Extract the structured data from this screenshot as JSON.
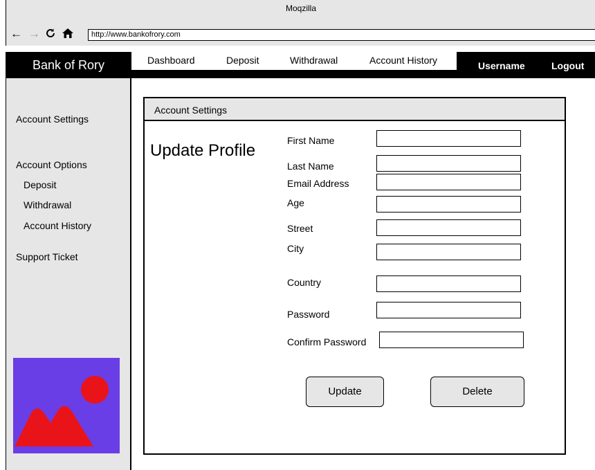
{
  "browser": {
    "window_title": "Moqzilla",
    "url": "http://www.bankofrory.com",
    "icons": [
      "arrow-left-icon",
      "arrow-right-icon",
      "reload-icon",
      "home-icon"
    ]
  },
  "topbar": {
    "brand": "Bank of Rory",
    "tabs": [
      {
        "label": "Dashboard"
      },
      {
        "label": "Deposit"
      },
      {
        "label": "Withdrawal"
      },
      {
        "label": "Account History"
      }
    ],
    "username": "Username",
    "logout": "Logout"
  },
  "sidebar": {
    "account_settings": "Account Settings",
    "account_options": "Account Options",
    "options": [
      {
        "label": "Deposit"
      },
      {
        "label": "Withdrawal"
      },
      {
        "label": "Account History"
      }
    ],
    "support_ticket": "Support Ticket",
    "image_icon": "image-placeholder-icon"
  },
  "panel": {
    "header": "Account Settings",
    "title": "Update Profile",
    "fields": [
      {
        "label": "First Name",
        "value": ""
      },
      {
        "label": "Last Name",
        "value": ""
      },
      {
        "label": "Email Address",
        "value": ""
      },
      {
        "label": "Age",
        "value": ""
      },
      {
        "label": "Street",
        "value": ""
      },
      {
        "label": "City",
        "value": ""
      },
      {
        "label": "Country",
        "value": ""
      },
      {
        "label": "Password",
        "value": ""
      },
      {
        "label": "Confirm Password",
        "value": ""
      }
    ],
    "update_button": "Update",
    "delete_button": "Delete"
  },
  "colors": {
    "chrome_gray": "#e6e6e6",
    "topbar_black": "#000000",
    "image_bg": "#6a3ee6",
    "image_shapes": "#e8141a"
  }
}
